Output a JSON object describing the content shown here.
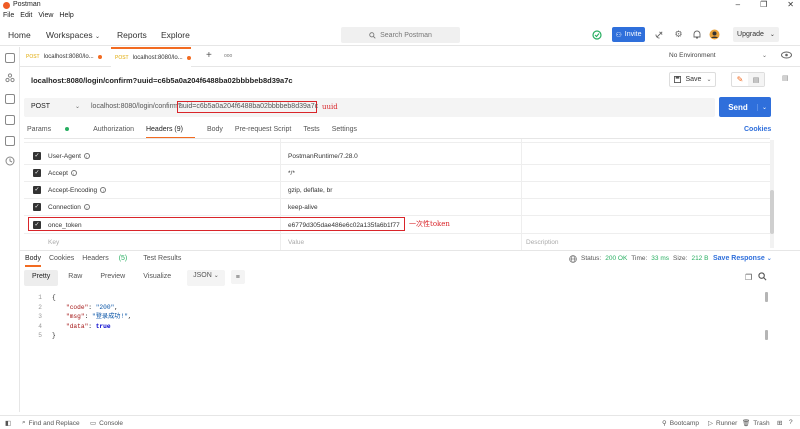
{
  "window": {
    "title": "Postman",
    "controls": [
      "–",
      "❐",
      "✕"
    ]
  },
  "menu": [
    "File",
    "Edit",
    "View",
    "Help"
  ],
  "topnav": {
    "home": "Home",
    "workspaces": "Workspaces",
    "reports": "Reports",
    "explore": "Explore",
    "search_placeholder": "Search Postman",
    "invite": "Invite",
    "upgrade": "Upgrade"
  },
  "tabs": [
    {
      "method": "POST",
      "label": "localhost:8080/lo..."
    },
    {
      "method": "POST",
      "label": "localhost:8080/lo..."
    }
  ],
  "tabs_more": "ooo",
  "environment": "No Environment",
  "request": {
    "name": "localhost:8080/login/confirm?uuid=c6b5a0a204f6488ba02bbbbeb8d39a7c",
    "save_label": "Save",
    "method": "POST",
    "url_prefix": "localhost:8080/login/confirm?",
    "url_highlight": "uuid=c6b5a0a204f6488ba02bbbbeb8d39a7c",
    "annotation_uuid": "uuid",
    "send_label": "Send"
  },
  "request_tabs": [
    "Params",
    "Authorization",
    "Headers (9)",
    "Body",
    "Pre-request Script",
    "Tests",
    "Settings"
  ],
  "cookies_label": "Cookies",
  "headers": [
    {
      "key": "User-Agent",
      "value": "PostmanRuntime/7.28.0"
    },
    {
      "key": "Accept",
      "value": "*/*"
    },
    {
      "key": "Accept-Encoding",
      "value": "gzip, deflate, br"
    },
    {
      "key": "Connection",
      "value": "keep-alive"
    },
    {
      "key": "once_token",
      "value": "e6779d305dae486e6c02a135fa6b1f77"
    }
  ],
  "headers_placeholder": {
    "key": "Key",
    "value": "Value",
    "description": "Description"
  },
  "annotation_token": "一次性token",
  "response": {
    "tabs": [
      "Body",
      "Cookies",
      "Headers",
      "(5)",
      "Test Results"
    ],
    "status_label": "Status:",
    "status_value": "200 OK",
    "time_label": "Time:",
    "time_value": "33 ms",
    "size_label": "Size:",
    "size_value": "212 B",
    "save_response": "Save Response",
    "view_modes": [
      "Pretty",
      "Raw",
      "Preview",
      "Visualize"
    ],
    "format": "JSON",
    "code_lines": [
      {
        "n": "1",
        "t": "{"
      },
      {
        "n": "2",
        "k": "\"code\"",
        "v": "\"200\"",
        "end": ","
      },
      {
        "n": "3",
        "k": "\"msg\"",
        "v": "\"登录成功!\"",
        "end": ","
      },
      {
        "n": "4",
        "k": "\"data\"",
        "b": "true",
        "end": ""
      },
      {
        "n": "5",
        "t": "}"
      }
    ]
  },
  "statusbar": {
    "find_replace": "Find and Replace",
    "console": "Console",
    "bootcamp": "Bootcamp",
    "runner": "Runner",
    "trash": "Trash"
  },
  "colors": {
    "accent": "#f26b21",
    "primary": "#2f6fdb",
    "success": "#27ae60",
    "annotation": "#d9252a"
  }
}
